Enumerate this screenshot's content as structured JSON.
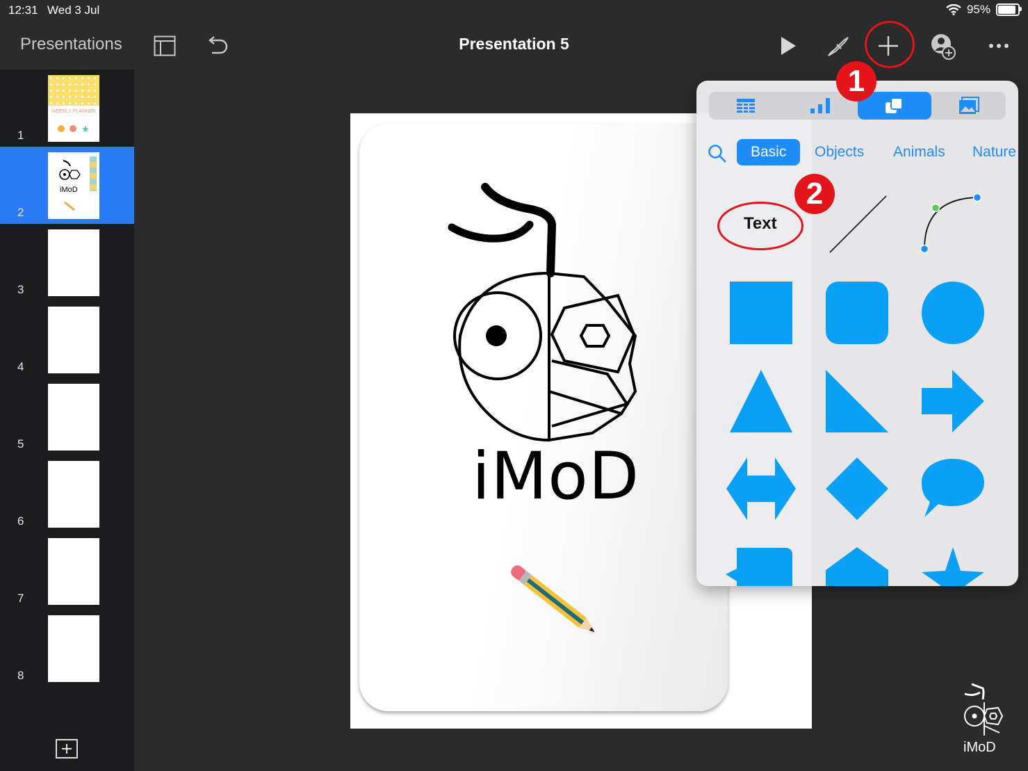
{
  "status_bar": {
    "time": "12:31",
    "date": "Wed 3 Jul",
    "battery": "95%",
    "battery_level": 0.95
  },
  "toolbar": {
    "back_label": "Presentations",
    "title": "Presentation 5",
    "icons": [
      "slide-view-icon",
      "undo-icon",
      "play-icon",
      "format-brush-icon",
      "add-icon",
      "collaborate-icon",
      "more-icon"
    ]
  },
  "navigator": {
    "slides": [
      {
        "number": "1",
        "planner_text": "WEEKLY PLANNER"
      },
      {
        "number": "2",
        "logo_text": "iMoD"
      },
      {
        "number": "3"
      },
      {
        "number": "4"
      },
      {
        "number": "5"
      },
      {
        "number": "6"
      },
      {
        "number": "7"
      },
      {
        "number": "8"
      }
    ],
    "selected": 2
  },
  "slide": {
    "logo_text": "iMoD"
  },
  "insert_popover": {
    "tabs": [
      "table-icon",
      "chart-icon",
      "shape-icon",
      "media-icon"
    ],
    "active_tab": 2,
    "categories": [
      "Basic",
      "Objects",
      "Animals",
      "Nature"
    ],
    "active_category": "Basic",
    "text_shape_label": "Text",
    "shape_color": "#0aa0f5"
  },
  "annotations": {
    "step1": "1",
    "step2": "2",
    "color": "#e4141a"
  },
  "watermark": {
    "text": "iMoD"
  }
}
